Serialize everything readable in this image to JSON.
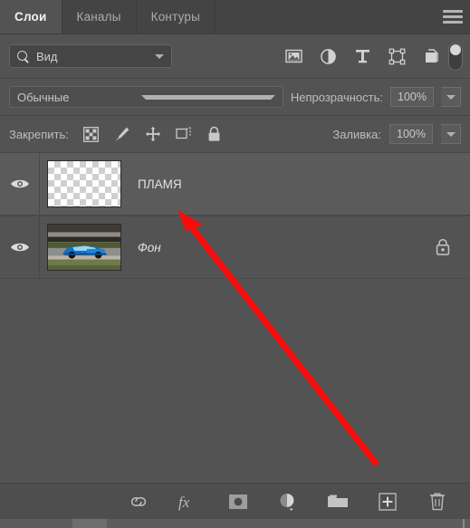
{
  "panel": {
    "tabs": [
      {
        "label": "Слои",
        "active": true
      },
      {
        "label": "Каналы",
        "active": false
      },
      {
        "label": "Контуры",
        "active": false
      }
    ],
    "menu_icon": "hamburger-menu-icon"
  },
  "filter": {
    "search_icon": "search-icon",
    "type_value": "Вид",
    "chevron_icon": "chevron-down-icon",
    "kind_icons": [
      {
        "name": "filter-pixel-layers-icon",
        "title": "Пиксельные слои"
      },
      {
        "name": "filter-adjustment-layers-icon",
        "title": "Корректирующие слои"
      },
      {
        "name": "filter-type-layers-icon",
        "title": "Текстовые слои"
      },
      {
        "name": "filter-shape-layers-icon",
        "title": "Слои-фигуры"
      },
      {
        "name": "filter-smart-object-icon",
        "title": "Смарт-объекты"
      }
    ],
    "toggle_name": "filter-enable-toggle"
  },
  "blend": {
    "mode_value": "Обычные",
    "opacity_label": "Непрозрачность:",
    "opacity_value": "100%",
    "chevron_icon": "chevron-down-icon"
  },
  "lock": {
    "label": "Закрепить:",
    "icons": [
      {
        "name": "lock-transparent-pixels-icon"
      },
      {
        "name": "lock-image-pixels-icon"
      },
      {
        "name": "lock-position-icon"
      },
      {
        "name": "lock-artboard-nesting-icon"
      },
      {
        "name": "lock-all-icon"
      }
    ],
    "fill_label": "Заливка:",
    "fill_value": "100%"
  },
  "layers": [
    {
      "name": "ПЛАМЯ",
      "visible": true,
      "selected": true,
      "locked": false,
      "thumbnail": "transparent-checkerboard",
      "italic": false
    },
    {
      "name": "Фон",
      "visible": true,
      "selected": false,
      "locked": true,
      "thumbnail": "blue-race-car-photo",
      "italic": true
    }
  ],
  "bottom_toolbar": [
    {
      "name": "link-layers-icon"
    },
    {
      "name": "layer-effects-fx-icon"
    },
    {
      "name": "add-layer-mask-icon"
    },
    {
      "name": "new-adjustment-layer-icon"
    },
    {
      "name": "new-group-icon"
    },
    {
      "name": "new-layer-icon"
    },
    {
      "name": "delete-layer-icon"
    }
  ],
  "annotation": {
    "arrow_color": "#fa0a0a",
    "name": "red-annotation-arrow",
    "points_to": "ПЛАМЯ"
  },
  "colors": {
    "panel_bg": "#535353",
    "tab_bg": "#444444",
    "selected_row": "#5b5b5b",
    "text": "#c8c8c8"
  }
}
